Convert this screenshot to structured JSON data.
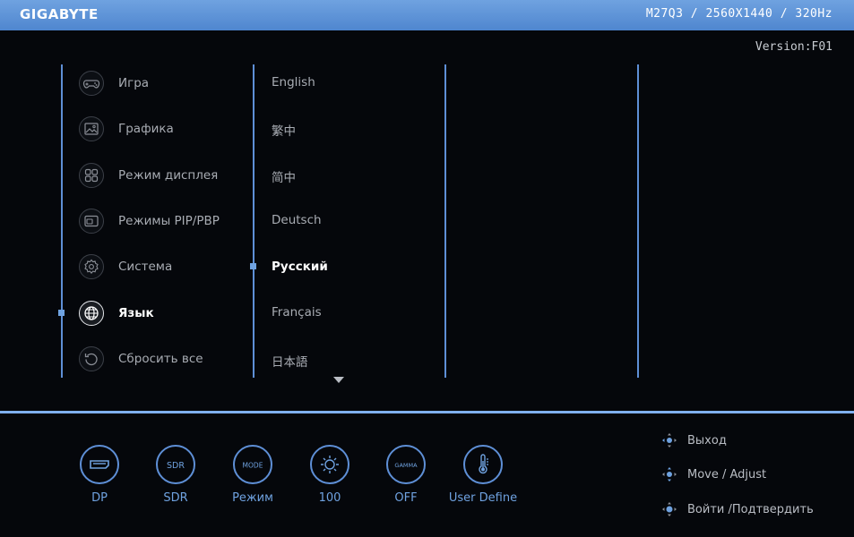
{
  "header": {
    "brand": "GIGABYTE",
    "model_info": "M27Q3 / 2560X1440 / 320Hz"
  },
  "version": "Version:F01",
  "menu": {
    "items": [
      {
        "label": "Игра",
        "icon": "gamepad-icon",
        "active": false
      },
      {
        "label": "Графика",
        "icon": "picture-icon",
        "active": false
      },
      {
        "label": "Режим дисплея",
        "icon": "display-mode-grid-icon",
        "active": false
      },
      {
        "label": "Режимы PIP/PBP",
        "icon": "pip-icon",
        "active": false
      },
      {
        "label": "Система",
        "icon": "gear-icon",
        "active": false
      },
      {
        "label": "Язык",
        "icon": "globe-icon",
        "active": true
      },
      {
        "label": "Сбросить все",
        "icon": "reset-icon",
        "active": false
      }
    ]
  },
  "languages": {
    "items": [
      {
        "label": "English",
        "active": false
      },
      {
        "label": "繁中",
        "active": false
      },
      {
        "label": "简中",
        "active": false
      },
      {
        "label": "Deutsch",
        "active": false
      },
      {
        "label": "Русский",
        "active": true
      },
      {
        "label": "Français",
        "active": false
      },
      {
        "label": "日本語",
        "active": false
      }
    ],
    "more_indicator": "chevron-down-icon"
  },
  "quick_settings": [
    {
      "icon_text": "",
      "icon": "input-port-icon",
      "label": "DP"
    },
    {
      "icon_text": "SDR",
      "icon": "sdr-icon",
      "label": "SDR"
    },
    {
      "icon_text": "MODE",
      "icon": "mode-icon",
      "label": "Режим"
    },
    {
      "icon_text": "",
      "icon": "brightness-icon",
      "label": "100"
    },
    {
      "icon_text": "GAMMA",
      "icon": "gamma-icon",
      "label": "OFF"
    },
    {
      "icon_text": "",
      "icon": "thermometer-icon",
      "label": "User Define"
    }
  ],
  "navigation_hints": [
    {
      "icon": "joystick-left-icon",
      "label": "Выход"
    },
    {
      "icon": "joystick-updown-icon",
      "label": "Move / Adjust"
    },
    {
      "icon": "joystick-press-icon",
      "label": "Войти /Подтвердить"
    }
  ],
  "colors": {
    "header_blue": "#5b93d9",
    "accent_blue": "#6fa2e0",
    "background": "#05070b"
  }
}
